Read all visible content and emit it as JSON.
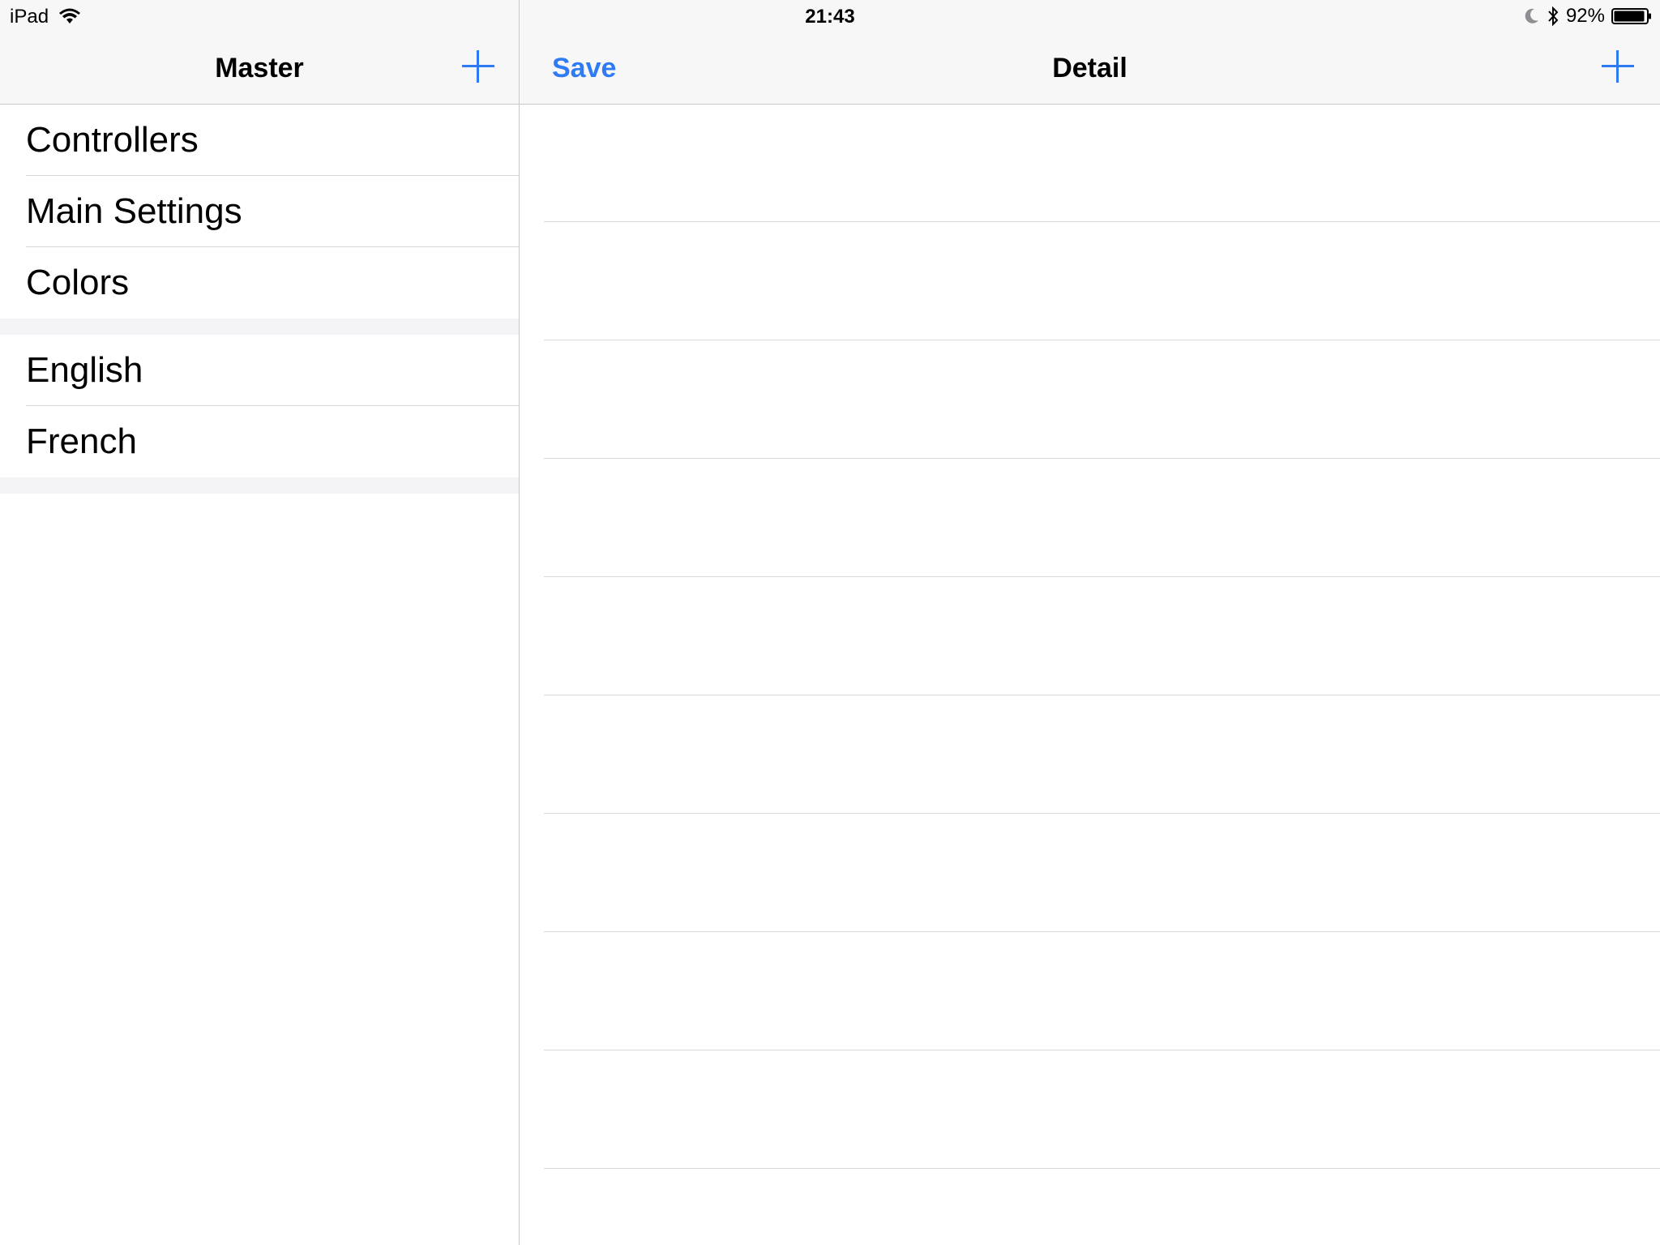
{
  "status_bar": {
    "device": "iPad",
    "time": "21:43",
    "battery_percent": "92%",
    "icons": [
      "wifi-icon",
      "moon-icon",
      "bluetooth-icon",
      "battery-icon"
    ]
  },
  "master": {
    "title": "Master",
    "add_icon": "plus-icon",
    "sections": [
      {
        "items": [
          "Controllers",
          "Main Settings",
          "Colors"
        ]
      },
      {
        "items": [
          "English",
          "French"
        ]
      }
    ]
  },
  "detail": {
    "title": "Detail",
    "save_label": "Save",
    "add_icon": "plus-icon"
  },
  "colors": {
    "accent": "#2f7bf6",
    "navbar_bg": "#f7f7f7",
    "separator": "#c8c7cc"
  }
}
